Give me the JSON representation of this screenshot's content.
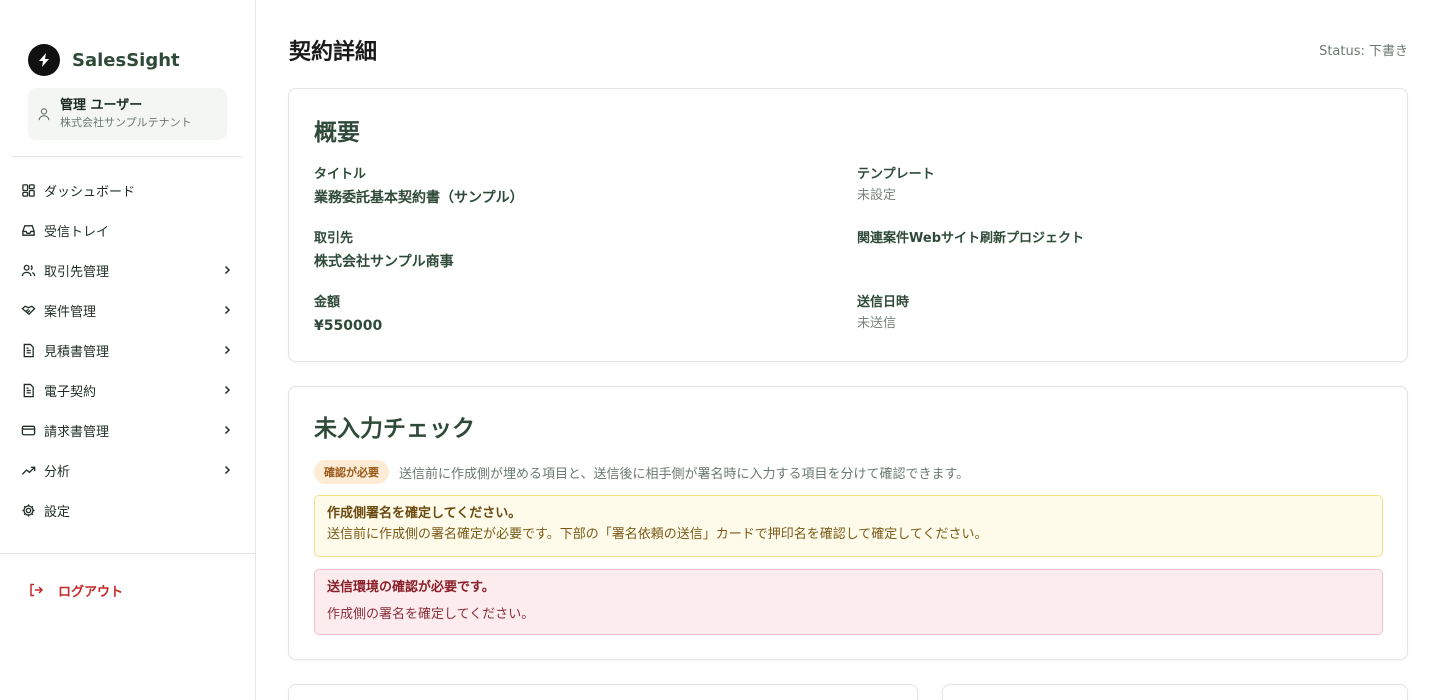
{
  "brand": {
    "name": "SalesSight"
  },
  "user": {
    "name": "管理 ユーザー",
    "tenant": "株式会社サンプルテナント"
  },
  "nav": [
    {
      "label": "ダッシュボード",
      "icon": "dashboard-icon",
      "chevron": false
    },
    {
      "label": "受信トレイ",
      "icon": "inbox-icon",
      "chevron": false
    },
    {
      "label": "取引先管理",
      "icon": "users-icon",
      "chevron": true
    },
    {
      "label": "案件管理",
      "icon": "handshake-icon",
      "chevron": true
    },
    {
      "label": "見積書管理",
      "icon": "document-icon",
      "chevron": true
    },
    {
      "label": "電子契約",
      "icon": "document-icon",
      "chevron": true
    },
    {
      "label": "請求書管理",
      "icon": "credit-card-icon",
      "chevron": true
    },
    {
      "label": "分析",
      "icon": "trending-up-icon",
      "chevron": true
    },
    {
      "label": "設定",
      "icon": "gear-icon",
      "chevron": false
    }
  ],
  "logout": {
    "label": "ログアウト"
  },
  "header": {
    "title": "契約詳細",
    "status": "Status: 下書き"
  },
  "overview": {
    "title": "概要",
    "fields": {
      "title_label": "タイトル",
      "title_value": "業務委託基本契約書（サンプル）",
      "template_label": "テンプレート",
      "template_value": "未設定",
      "client_label": "取引先",
      "client_value": "株式会社サンプル商事",
      "related_label": "関連案件Webサイト刷新プロジェクト",
      "amount_label": "金額",
      "amount_value": "¥550000",
      "sent_label": "送信日時",
      "sent_value": "未送信"
    }
  },
  "check": {
    "title": "未入力チェック",
    "badge": "確認が必要",
    "description": "送信前に作成側が埋める項目と、送信後に相手側が署名時に入力する項目を分けて確認できます。",
    "warning": {
      "title": "作成側署名を確定してください。",
      "body": "送信前に作成側の署名確定が必要です。下部の「署名依頼の送信」カードで押印名を確認して確定してください。"
    },
    "error": {
      "title": "送信環境の確認が必要です。",
      "body": "作成側の署名を確定してください。"
    }
  },
  "colors": {
    "accent": "#2f4a38",
    "danger": "#c62828",
    "warn_bg": "#fefbea",
    "err_bg": "#fdecee"
  }
}
